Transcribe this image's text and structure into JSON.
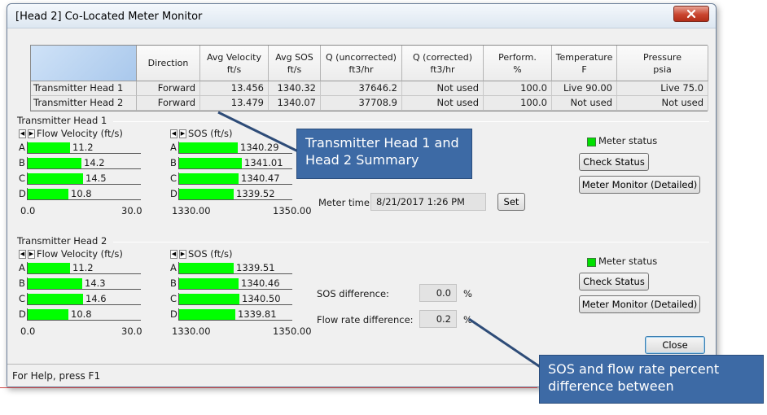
{
  "window": {
    "title": "[Head 2] Co-Located Meter Monitor"
  },
  "summary_table": {
    "columns": [
      {
        "l1": "Direction",
        "l2": ""
      },
      {
        "l1": "Avg Velocity",
        "l2": "ft/s"
      },
      {
        "l1": "Avg SOS",
        "l2": "ft/s"
      },
      {
        "l1": "Q (uncorrected)",
        "l2": "ft3/hr"
      },
      {
        "l1": "Q (corrected)",
        "l2": "ft3/hr"
      },
      {
        "l1": "Perform.",
        "l2": "%"
      },
      {
        "l1": "Temperature",
        "l2": "F"
      },
      {
        "l1": "Pressure",
        "l2": "psia"
      }
    ],
    "rows": [
      {
        "label": "Transmitter Head 1",
        "cells": [
          "Forward",
          "13.456",
          "1340.32",
          "37646.2",
          "Not used",
          "100.0",
          "Live 90.00",
          "Live 75.0"
        ]
      },
      {
        "label": "Transmitter Head 2",
        "cells": [
          "Forward",
          "13.479",
          "1340.07",
          "37708.9",
          "Not used",
          "100.0",
          "Not used",
          "Not used"
        ]
      }
    ]
  },
  "head1": {
    "label": "Transmitter Head 1",
    "velocity": {
      "title": "Flow Velocity (ft/s)",
      "min_label": "0.0",
      "max_label": "30.0",
      "range": [
        0,
        30
      ],
      "bars": [
        {
          "letter": "A",
          "value": "11.2",
          "num": 11.2
        },
        {
          "letter": "B",
          "value": "14.2",
          "num": 14.2
        },
        {
          "letter": "C",
          "value": "14.5",
          "num": 14.5
        },
        {
          "letter": "D",
          "value": "10.8",
          "num": 10.8
        }
      ]
    },
    "sos": {
      "title": "SOS (ft/s)",
      "min_label": "1330.00",
      "max_label": "1350.00",
      "range": [
        1330,
        1350
      ],
      "bars": [
        {
          "letter": "A",
          "value": "1340.29",
          "num": 1340.29
        },
        {
          "letter": "B",
          "value": "1341.01",
          "num": 1341.01
        },
        {
          "letter": "C",
          "value": "1340.47",
          "num": 1340.47
        },
        {
          "letter": "D",
          "value": "1339.52",
          "num": 1339.52
        }
      ]
    },
    "meter_status_label": "Meter status",
    "check_status_label": "Check Status",
    "meter_monitor_label": "Meter Monitor (Detailed)",
    "meter_time_label": "Meter time:",
    "meter_time_value": "8/21/2017 1:26 PM",
    "set_label": "Set"
  },
  "head2": {
    "label": "Transmitter Head 2",
    "velocity": {
      "title": "Flow Velocity (ft/s)",
      "min_label": "0.0",
      "max_label": "30.0",
      "range": [
        0,
        30
      ],
      "bars": [
        {
          "letter": "A",
          "value": "11.2",
          "num": 11.2
        },
        {
          "letter": "B",
          "value": "14.3",
          "num": 14.3
        },
        {
          "letter": "C",
          "value": "14.6",
          "num": 14.6
        },
        {
          "letter": "D",
          "value": "10.8",
          "num": 10.8
        }
      ]
    },
    "sos": {
      "title": "SOS (ft/s)",
      "min_label": "1330.00",
      "max_label": "1350.00",
      "range": [
        1330,
        1350
      ],
      "bars": [
        {
          "letter": "A",
          "value": "1339.51",
          "num": 1339.51
        },
        {
          "letter": "B",
          "value": "1340.46",
          "num": 1340.46
        },
        {
          "letter": "C",
          "value": "1340.50",
          "num": 1340.5
        },
        {
          "letter": "D",
          "value": "1339.81",
          "num": 1339.81
        }
      ]
    },
    "meter_status_label": "Meter status",
    "check_status_label": "Check Status",
    "meter_monitor_label": "Meter Monitor (Detailed)",
    "sos_diff_label": "SOS difference:",
    "sos_diff_value": "0.0",
    "flow_diff_label": "Flow rate difference:",
    "flow_diff_value": "0.2",
    "percent_sign": "%"
  },
  "close_label": "Close",
  "status_bar": "For Help, press F1",
  "callouts": {
    "summary": "Transmitter Head 1 and Head 2 Summary",
    "difference": "SOS and flow rate percent difference between"
  },
  "colors": {
    "bar_fill": "#00ff00",
    "callout": "#3d6aa5",
    "status_ok": "#00e000"
  }
}
